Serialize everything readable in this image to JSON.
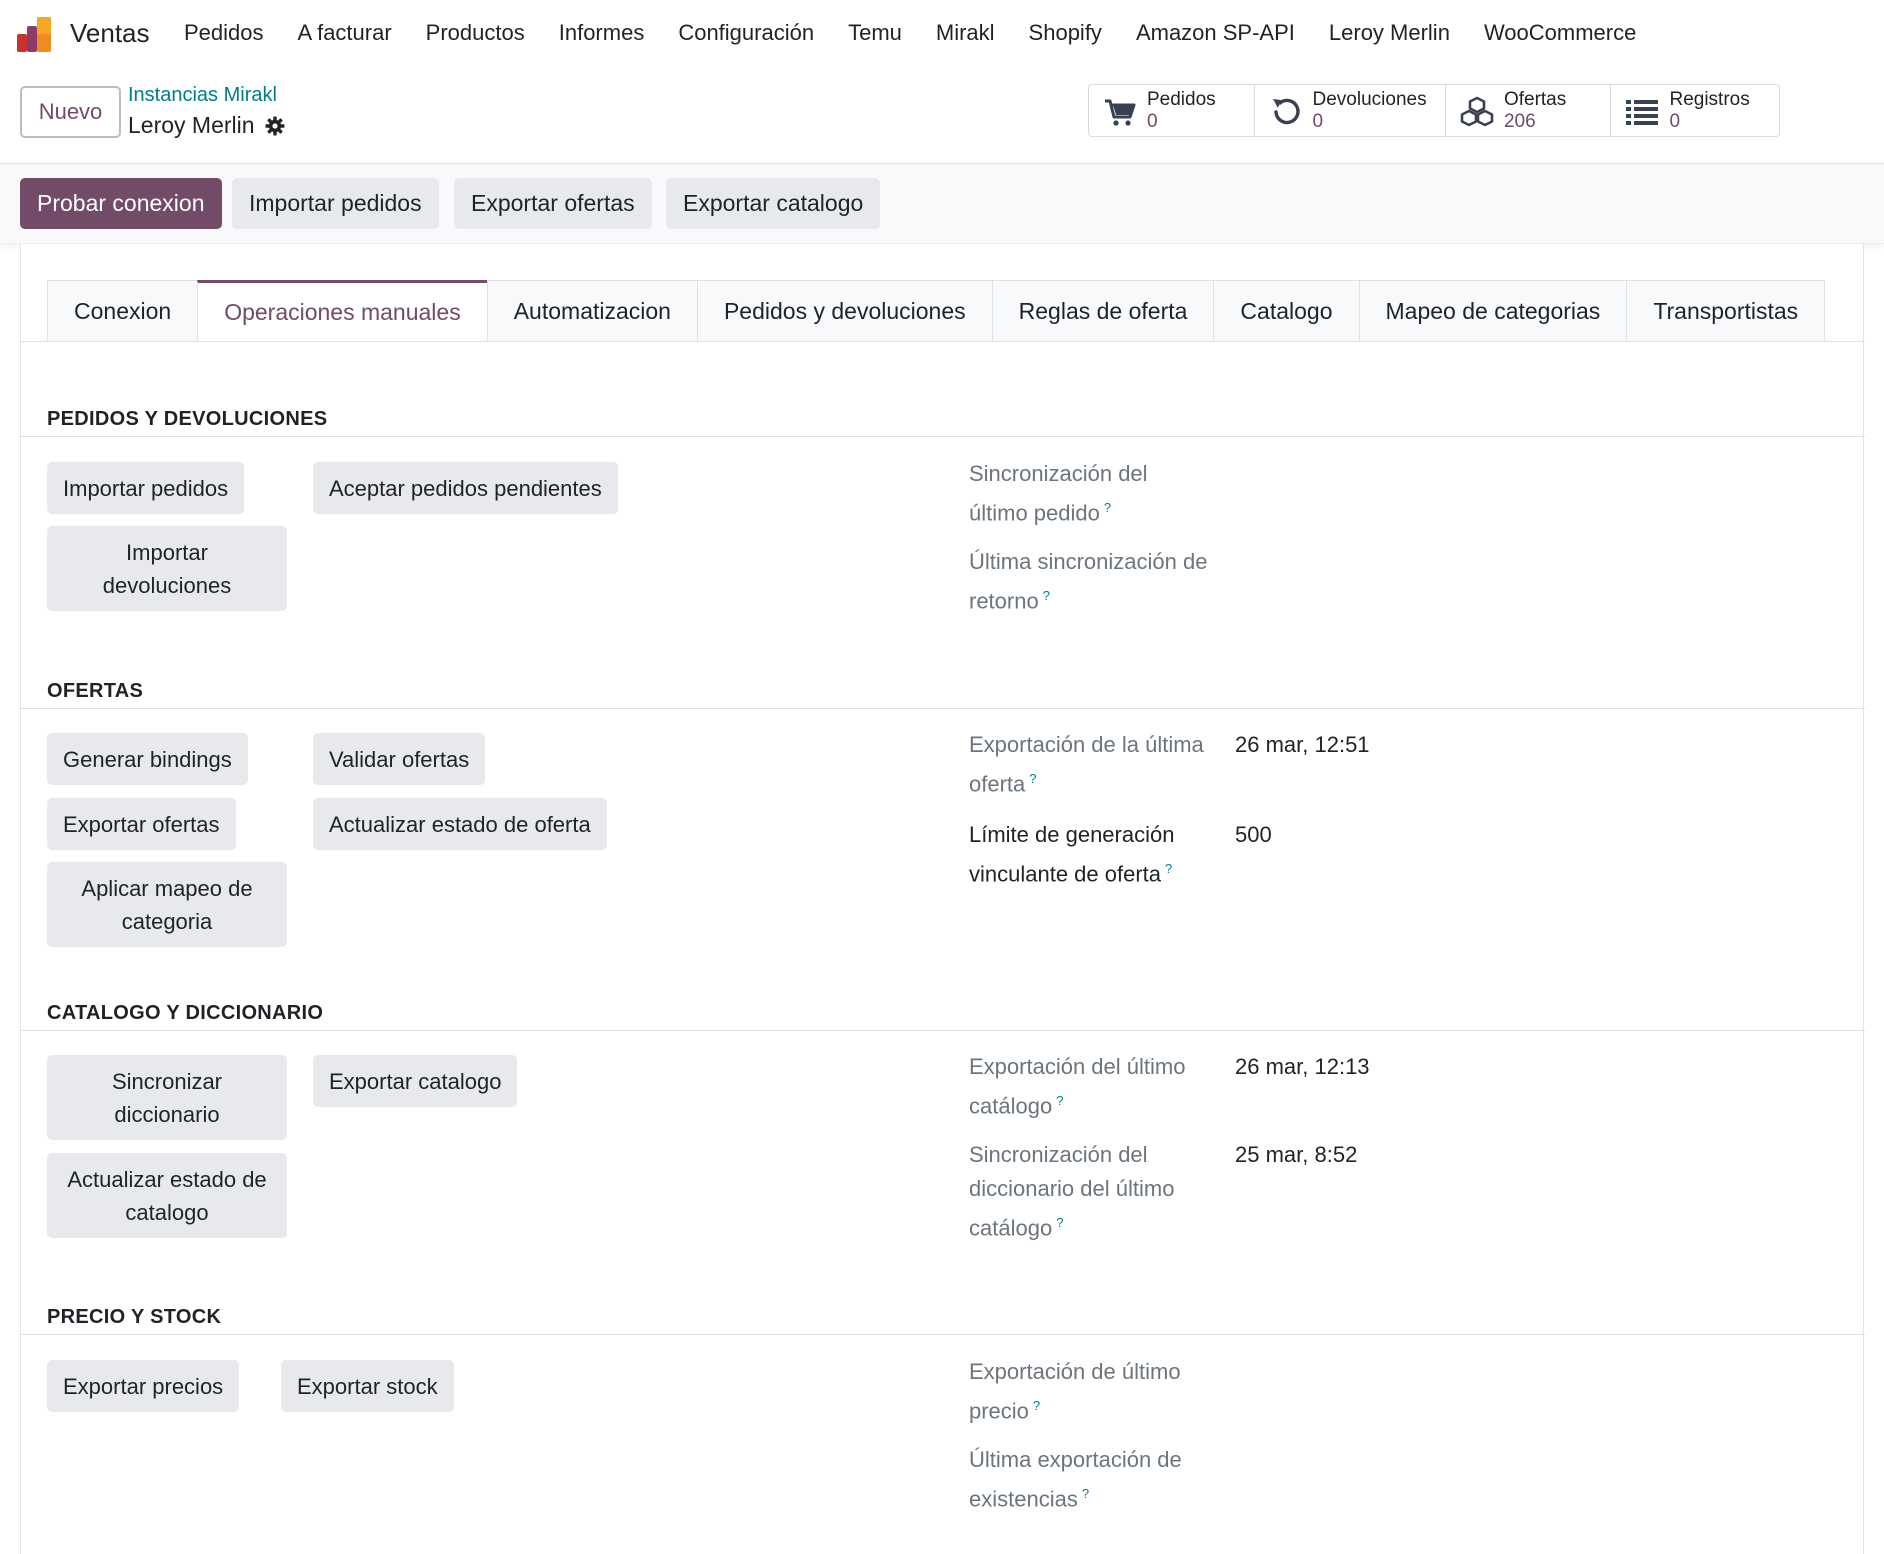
{
  "navbar": {
    "app_name": "Ventas",
    "menu": [
      "Pedidos",
      "A facturar",
      "Productos",
      "Informes",
      "Configuración",
      "Temu",
      "Mirakl",
      "Shopify",
      "Amazon SP-API",
      "Leroy Merlin",
      "WooCommerce"
    ]
  },
  "control": {
    "new_label": "Nuevo",
    "breadcrumb_parent": "Instancias Mirakl",
    "breadcrumb_current": "Leroy Merlin",
    "smart_buttons": [
      {
        "label": "Pedidos",
        "value": "0",
        "icon": "cart-icon"
      },
      {
        "label": "Devoluciones",
        "value": "0",
        "icon": "undo-icon"
      },
      {
        "label": "Ofertas",
        "value": "206",
        "icon": "cubes-icon"
      },
      {
        "label": "Registros",
        "value": "0",
        "icon": "list-icon"
      }
    ]
  },
  "header_buttons": {
    "test_connection": "Probar conexion",
    "import_orders": "Importar pedidos",
    "export_offers": "Exportar ofertas",
    "export_catalog": "Exportar catalogo"
  },
  "tabs": [
    "Conexion",
    "Operaciones manuales",
    "Automatizacion",
    "Pedidos y devoluciones",
    "Reglas de oferta",
    "Catalogo",
    "Mapeo de categorias",
    "Transportistas"
  ],
  "active_tab": "Operaciones manuales",
  "sections": {
    "orders": {
      "title": "PEDIDOS Y DEVOLUCIONES",
      "buttons": [
        "Importar pedidos",
        "Aceptar pedidos pendientes",
        "Importar devoluciones"
      ],
      "fields": [
        {
          "label": "Sincronización del último pedido",
          "value": ""
        },
        {
          "label": "Última sincronización de retorno",
          "value": ""
        }
      ]
    },
    "offers": {
      "title": "OFERTAS",
      "buttons": [
        "Generar bindings",
        "Validar ofertas",
        "Exportar ofertas",
        "Actualizar estado de oferta",
        "Aplicar mapeo de categoria"
      ],
      "fields": [
        {
          "label": "Exportación de la última oferta",
          "value": "26 mar, 12:51"
        },
        {
          "label": "Límite de generación vinculante de oferta",
          "value": "500"
        }
      ]
    },
    "catalog": {
      "title": "CATALOGO Y DICCIONARIO",
      "buttons": [
        "Sincronizar diccionario",
        "Exportar catalogo",
        "Actualizar estado de catalogo"
      ],
      "fields": [
        {
          "label": "Exportación del último catálogo",
          "value": "26 mar, 12:13"
        },
        {
          "label": "Sincronización del diccionario del último catálogo",
          "value": "25 mar, 8:52"
        }
      ]
    },
    "stock": {
      "title": "PRECIO Y STOCK",
      "buttons": [
        "Exportar precios",
        "Exportar stock"
      ],
      "fields": [
        {
          "label": "Exportación de último precio",
          "value": ""
        },
        {
          "label": "Última exportación de existencias",
          "value": ""
        }
      ]
    }
  },
  "help_mark": "?",
  "colors": {
    "brand": "#714b67",
    "link": "#017e84",
    "muted": "#6c757d"
  }
}
